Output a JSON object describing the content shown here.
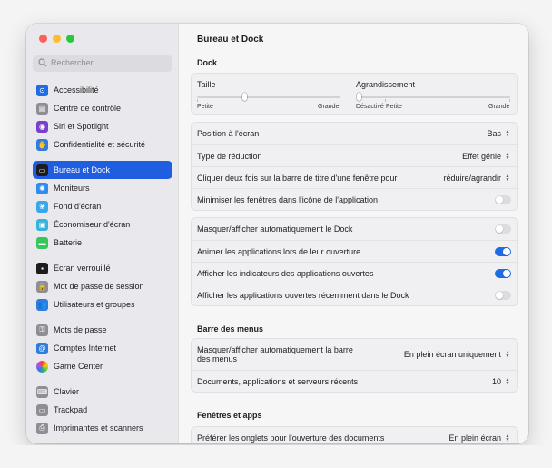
{
  "sidebar": {
    "search_placeholder": "Rechercher",
    "items": [
      {
        "label": "Accessibilité",
        "icon": "accessibility-icon",
        "color": "#1f6de4",
        "glyph": "⊙"
      },
      {
        "label": "Centre de contrôle",
        "icon": "control-center-icon",
        "color": "#8e8e93",
        "glyph": "▤"
      },
      {
        "label": "Siri et Spotlight",
        "icon": "siri-icon",
        "color": "#7b3fd0",
        "glyph": "◉"
      },
      {
        "label": "Confidentialité et sécurité",
        "icon": "hand-icon",
        "color": "#2f7de1",
        "glyph": "✋"
      },
      {
        "label": "Bureau et Dock",
        "icon": "dock-icon",
        "color": "#1d1d1f",
        "glyph": "▭",
        "active": true
      },
      {
        "label": "Moniteurs",
        "icon": "display-icon",
        "color": "#2f8cf0",
        "glyph": "✺"
      },
      {
        "label": "Fond d'écran",
        "icon": "wallpaper-icon",
        "color": "#37a8f0",
        "glyph": "❀"
      },
      {
        "label": "Économiseur d'écran",
        "icon": "screensaver-icon",
        "color": "#39b3d8",
        "glyph": "▣"
      },
      {
        "label": "Batterie",
        "icon": "battery-icon",
        "color": "#34c759",
        "glyph": "▬"
      },
      {
        "label": "Écran verrouillé",
        "icon": "lock-screen-icon",
        "color": "#1d1d1f",
        "glyph": "▪"
      },
      {
        "label": "Mot de passe de session",
        "icon": "lock-icon",
        "color": "#8e8e93",
        "glyph": "🔒"
      },
      {
        "label": "Utilisateurs et groupes",
        "icon": "users-icon",
        "color": "#2f7de1",
        "glyph": "👥"
      },
      {
        "label": "Mots de passe",
        "icon": "key-icon",
        "color": "#8e8e93",
        "glyph": "⚿"
      },
      {
        "label": "Comptes Internet",
        "icon": "at-icon",
        "color": "#2f7de1",
        "glyph": "@"
      },
      {
        "label": "Game Center",
        "icon": "game-center-icon",
        "color": "#ffffff",
        "glyph": "●"
      },
      {
        "label": "Clavier",
        "icon": "keyboard-icon",
        "color": "#8e8e93",
        "glyph": "⌨"
      },
      {
        "label": "Trackpad",
        "icon": "trackpad-icon",
        "color": "#8e8e93",
        "glyph": "▭"
      },
      {
        "label": "Imprimantes et scanners",
        "icon": "printer-icon",
        "color": "#8e8e93",
        "glyph": "⎙"
      }
    ]
  },
  "main": {
    "title": "Bureau et Dock",
    "dock": {
      "section_title": "Dock",
      "size": {
        "label": "Taille",
        "min_label": "Petite",
        "max_label": "Grande",
        "value": 0.33
      },
      "magnification": {
        "label": "Agrandissement",
        "off_label": "Désactivé",
        "min_label": "Petite",
        "max_label": "Grande",
        "value": 0.0
      },
      "rows1": [
        {
          "label": "Position à l'écran",
          "value": "Bas"
        },
        {
          "label": "Type de réduction",
          "value": "Effet génie"
        },
        {
          "label": "Cliquer deux fois sur la barre de titre d'une fenêtre pour",
          "value": "réduire/agrandir"
        },
        {
          "label": "Minimiser les fenêtres dans l'icône de l'application",
          "toggle": false
        }
      ],
      "rows2": [
        {
          "label": "Masquer/afficher automatiquement le Dock",
          "toggle": false
        },
        {
          "label": "Animer les applications lors de leur ouverture",
          "toggle": true
        },
        {
          "label": "Afficher les indicateurs des applications ouvertes",
          "toggle": true
        },
        {
          "label": "Afficher les applications ouvertes récemment dans le Dock",
          "toggle": false
        }
      ]
    },
    "menubar": {
      "section_title": "Barre des menus",
      "rows": [
        {
          "label": "Masquer/afficher automatiquement la barre des menus",
          "value": "En plein écran uniquement"
        },
        {
          "label": "Documents, applications et serveurs récents",
          "value": "10"
        }
      ]
    },
    "windows": {
      "section_title": "Fenêtres et apps",
      "rows": [
        {
          "label": "Préférer les onglets pour l'ouverture des documents",
          "value": "En plein écran"
        }
      ]
    }
  },
  "colors": {
    "accent": "#1f5ee0",
    "toggle_on": "#1f6de4",
    "close": "#ff5f57",
    "minimize": "#febc2e",
    "zoom": "#28c840"
  }
}
